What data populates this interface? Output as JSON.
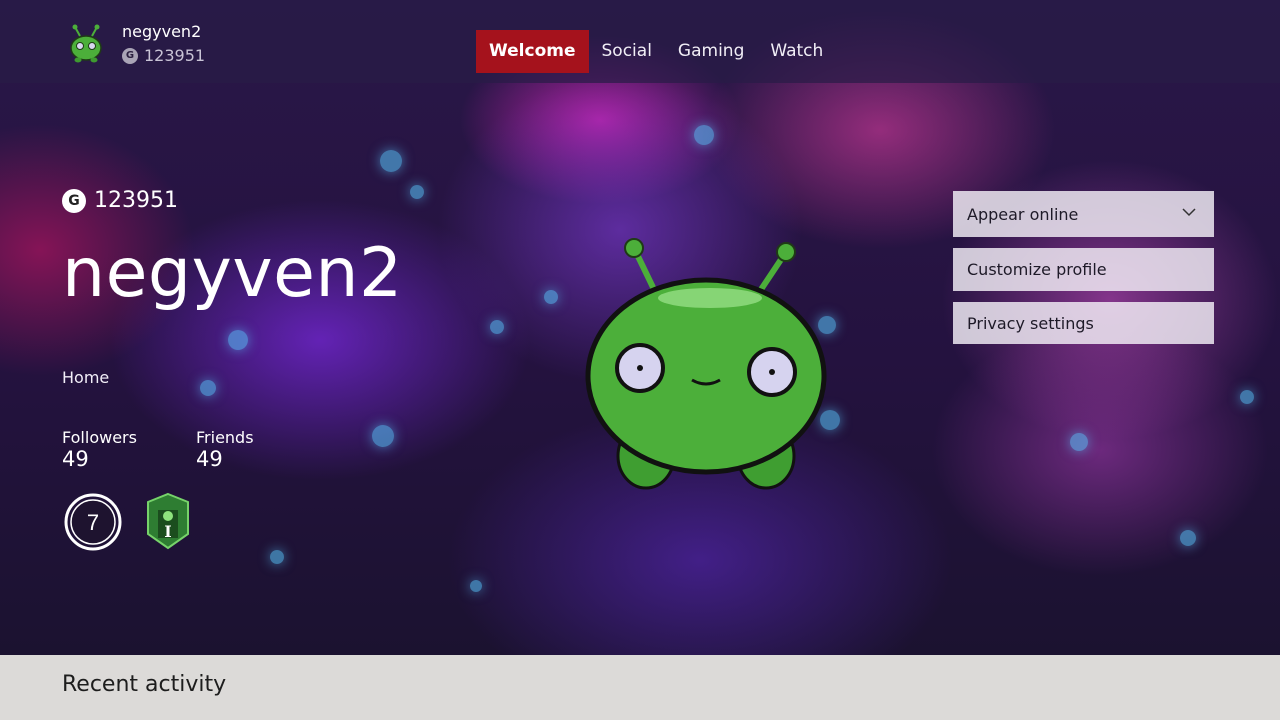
{
  "topbar": {
    "username": "negyven2",
    "gamerscore": "123951",
    "gamerscore_badge": "G"
  },
  "nav": {
    "tabs": [
      {
        "label": "Welcome",
        "active": true
      },
      {
        "label": "Social",
        "active": false
      },
      {
        "label": "Gaming",
        "active": false
      },
      {
        "label": "Watch",
        "active": false
      }
    ]
  },
  "profile": {
    "gamerscore_badge": "G",
    "gamerscore": "123951",
    "gamertag": "negyven2",
    "home_label": "Home",
    "followers_label": "Followers",
    "followers_count": "49",
    "friends_label": "Friends",
    "friends_count": "49",
    "reputation_level": "7",
    "tier_letter": "I"
  },
  "actions": {
    "presence": "Appear online",
    "customize": "Customize profile",
    "privacy": "Privacy settings"
  },
  "footer": {
    "recent_activity": "Recent activity"
  },
  "icons": {
    "avatar": "green-alien-avatar",
    "reputation": "reputation-ring-icon",
    "tier": "tier-shield-icon",
    "dropdown": "chevron-down-icon"
  },
  "colors": {
    "accent_tab": "#a5121c",
    "avatar_green": "#4caf3a"
  }
}
